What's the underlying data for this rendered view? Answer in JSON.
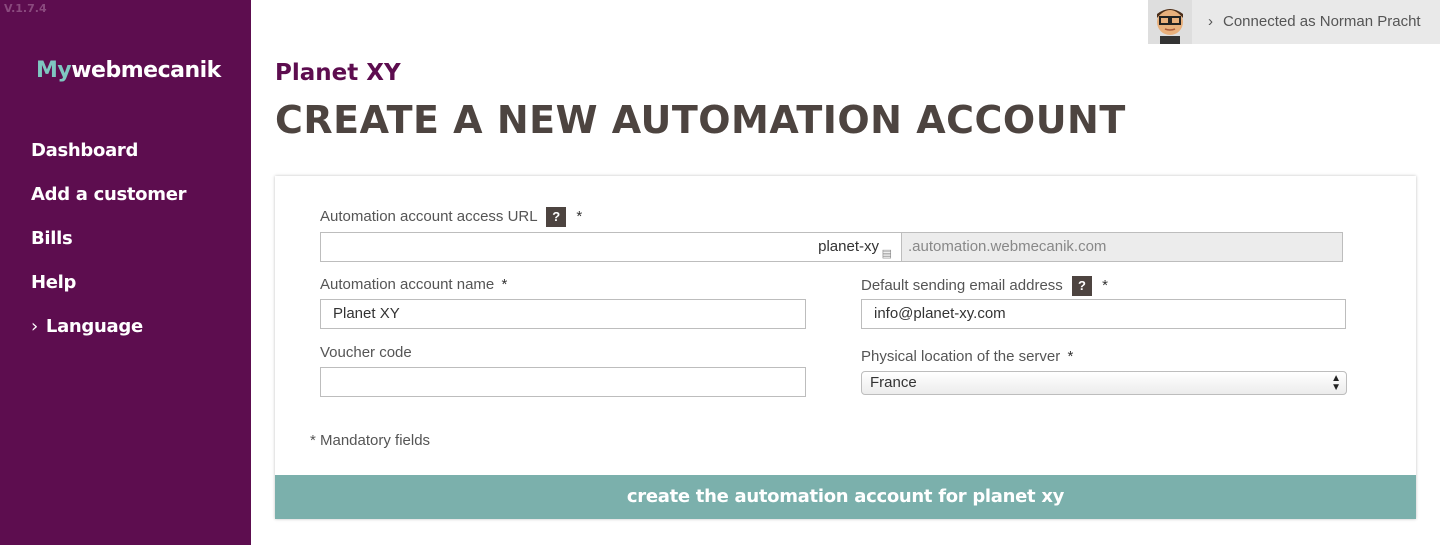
{
  "version": "V.1.7.4",
  "logo": {
    "prefix": "My",
    "rest": "webmecanik"
  },
  "sidebar": {
    "items": [
      {
        "label": "Dashboard"
      },
      {
        "label": "Add a customer"
      },
      {
        "label": "Bills"
      },
      {
        "label": "Help"
      },
      {
        "label": "Language"
      }
    ]
  },
  "header": {
    "user_text": "Connected as Norman Pracht"
  },
  "main": {
    "brand": "Planet XY",
    "title": "CREATE A NEW AUTOMATION ACCOUNT"
  },
  "form": {
    "help_glyph": "?",
    "required_mark": "*",
    "url_label": "Automation account access URL",
    "url_value": "planet-xy",
    "url_suffix": ".automation.webmecanik.com",
    "name_label": "Automation account name",
    "name_value": "Planet XY",
    "email_label": "Default sending email address",
    "email_value": "info@planet-xy.com",
    "voucher_label": "Voucher code",
    "voucher_value": "",
    "server_label": "Physical location of the server",
    "server_value": "France",
    "mandatory_note": "* Mandatory fields",
    "submit_label": "create the automation account for planet xy"
  },
  "colors": {
    "sidebar": "#5d0d4f",
    "brand": "#5d0d4f",
    "accent_button": "#7bb0ac",
    "title": "#4d4440"
  }
}
